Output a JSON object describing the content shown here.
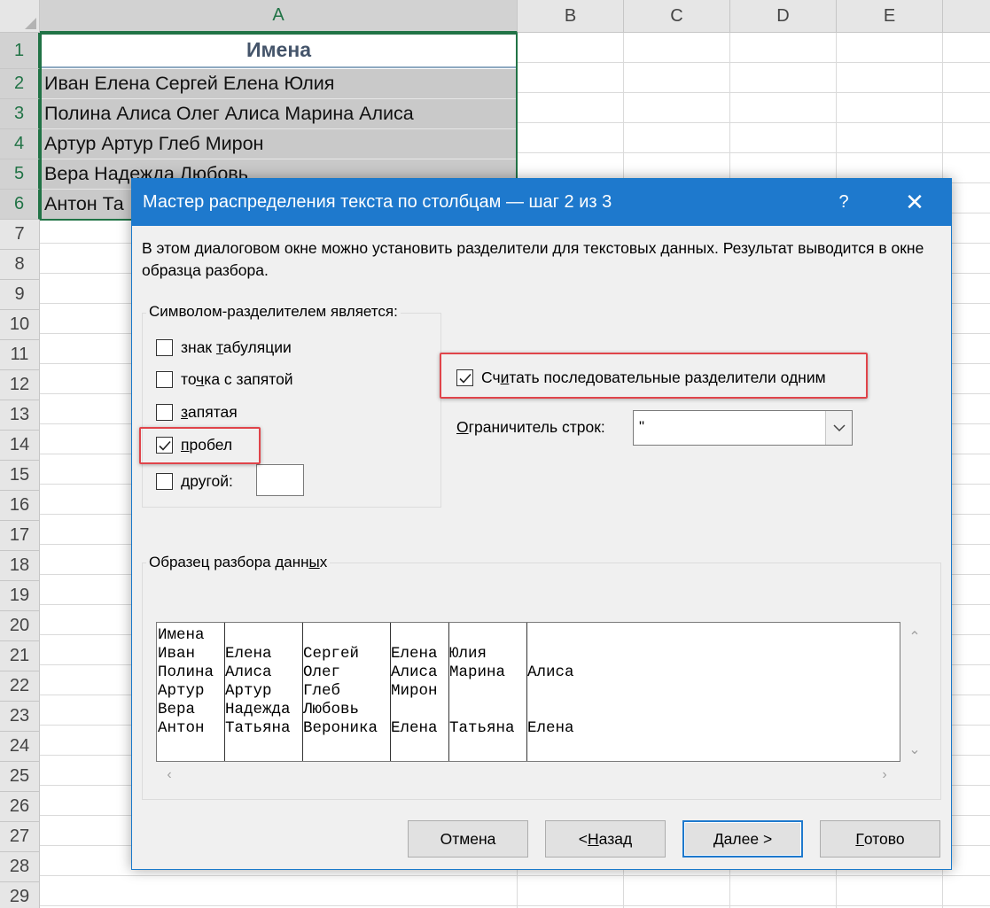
{
  "sheet": {
    "columns": [
      "A",
      "B",
      "C",
      "D",
      "E"
    ],
    "rows": [
      "1",
      "2",
      "3",
      "4",
      "5",
      "6",
      "7",
      "8",
      "9",
      "10",
      "11",
      "12",
      "13",
      "14",
      "15",
      "16",
      "17",
      "18",
      "19",
      "20",
      "21",
      "22",
      "23",
      "24",
      "25",
      "26",
      "27",
      "28",
      "29"
    ],
    "cells": {
      "a1": "Имена",
      "a2": "Иван Елена Сергей Елена Юлия",
      "a3": "Полина Алиса Олег Алиса Марина Алиса",
      "a4": "Артур Артур Глеб Мирон",
      "a5": "Вера Надежда Любовь",
      "a6": "Антон Та"
    },
    "colors": {
      "selection": "#217346",
      "shaded": "#c9c9c9",
      "header_text": "#44546a"
    }
  },
  "dialog": {
    "title": "Мастер распределения текста по столбцам — шаг 2 из 3",
    "help_label": "?",
    "close_label": "✕",
    "description": "В этом диалоговом окне можно установить разделители для текстовых данных. Результат выводится в окне образца разбора.",
    "delimiters": {
      "legend": "Символом-разделителем является:",
      "tab": {
        "pre": "знак ",
        "ul": "т",
        "post": "абуляции",
        "checked": false
      },
      "semicolon": {
        "pre": "то",
        "ul": "ч",
        "post": "ка с запятой",
        "checked": false
      },
      "comma": {
        "pre": "",
        "ul": "з",
        "post": "апятая",
        "checked": false
      },
      "space": {
        "pre": "",
        "ul": "п",
        "post": "робел",
        "checked": true
      },
      "other": {
        "pre": "",
        "ul": "д",
        "post": "ругой:",
        "checked": false,
        "value": ""
      }
    },
    "consecutive": {
      "pre": "Сч",
      "ul": "и",
      "post": "тать последовательные разделители одним",
      "checked": true
    },
    "qualifier": {
      "pre": "",
      "ul": "О",
      "post": "граничитель строк:",
      "value": "\""
    },
    "preview": {
      "legend_pre": "Образец разбора данн",
      "legend_ul": "ы",
      "legend_post": "х",
      "rows": [
        [
          "Имена",
          "",
          "",
          "",
          "",
          ""
        ],
        [
          "Иван",
          "Елена",
          "Сергей",
          "Елена",
          "Юлия",
          ""
        ],
        [
          "Полина",
          "Алиса",
          "Олег",
          "Алиса",
          "Марина",
          "Алиса"
        ],
        [
          "Артур",
          "Артур",
          "Глеб",
          "Мирон",
          "",
          ""
        ],
        [
          "Вера",
          "Надежда",
          "Любовь",
          "",
          "",
          ""
        ],
        [
          "Антон",
          "Татьяна",
          "Вероника",
          "Елена",
          "Татьяна",
          "Елена"
        ]
      ]
    },
    "buttons": {
      "cancel": {
        "label": "Отмена"
      },
      "back": {
        "pre": "< ",
        "ul": "Н",
        "post": "азад"
      },
      "next": {
        "pre": "",
        "ul": "Д",
        "post": "алее >"
      },
      "finish": {
        "pre": "",
        "ul": "Г",
        "post": "отово"
      }
    },
    "colors": {
      "titlebar": "#1e79cd",
      "highlight": "#e0444a"
    }
  }
}
